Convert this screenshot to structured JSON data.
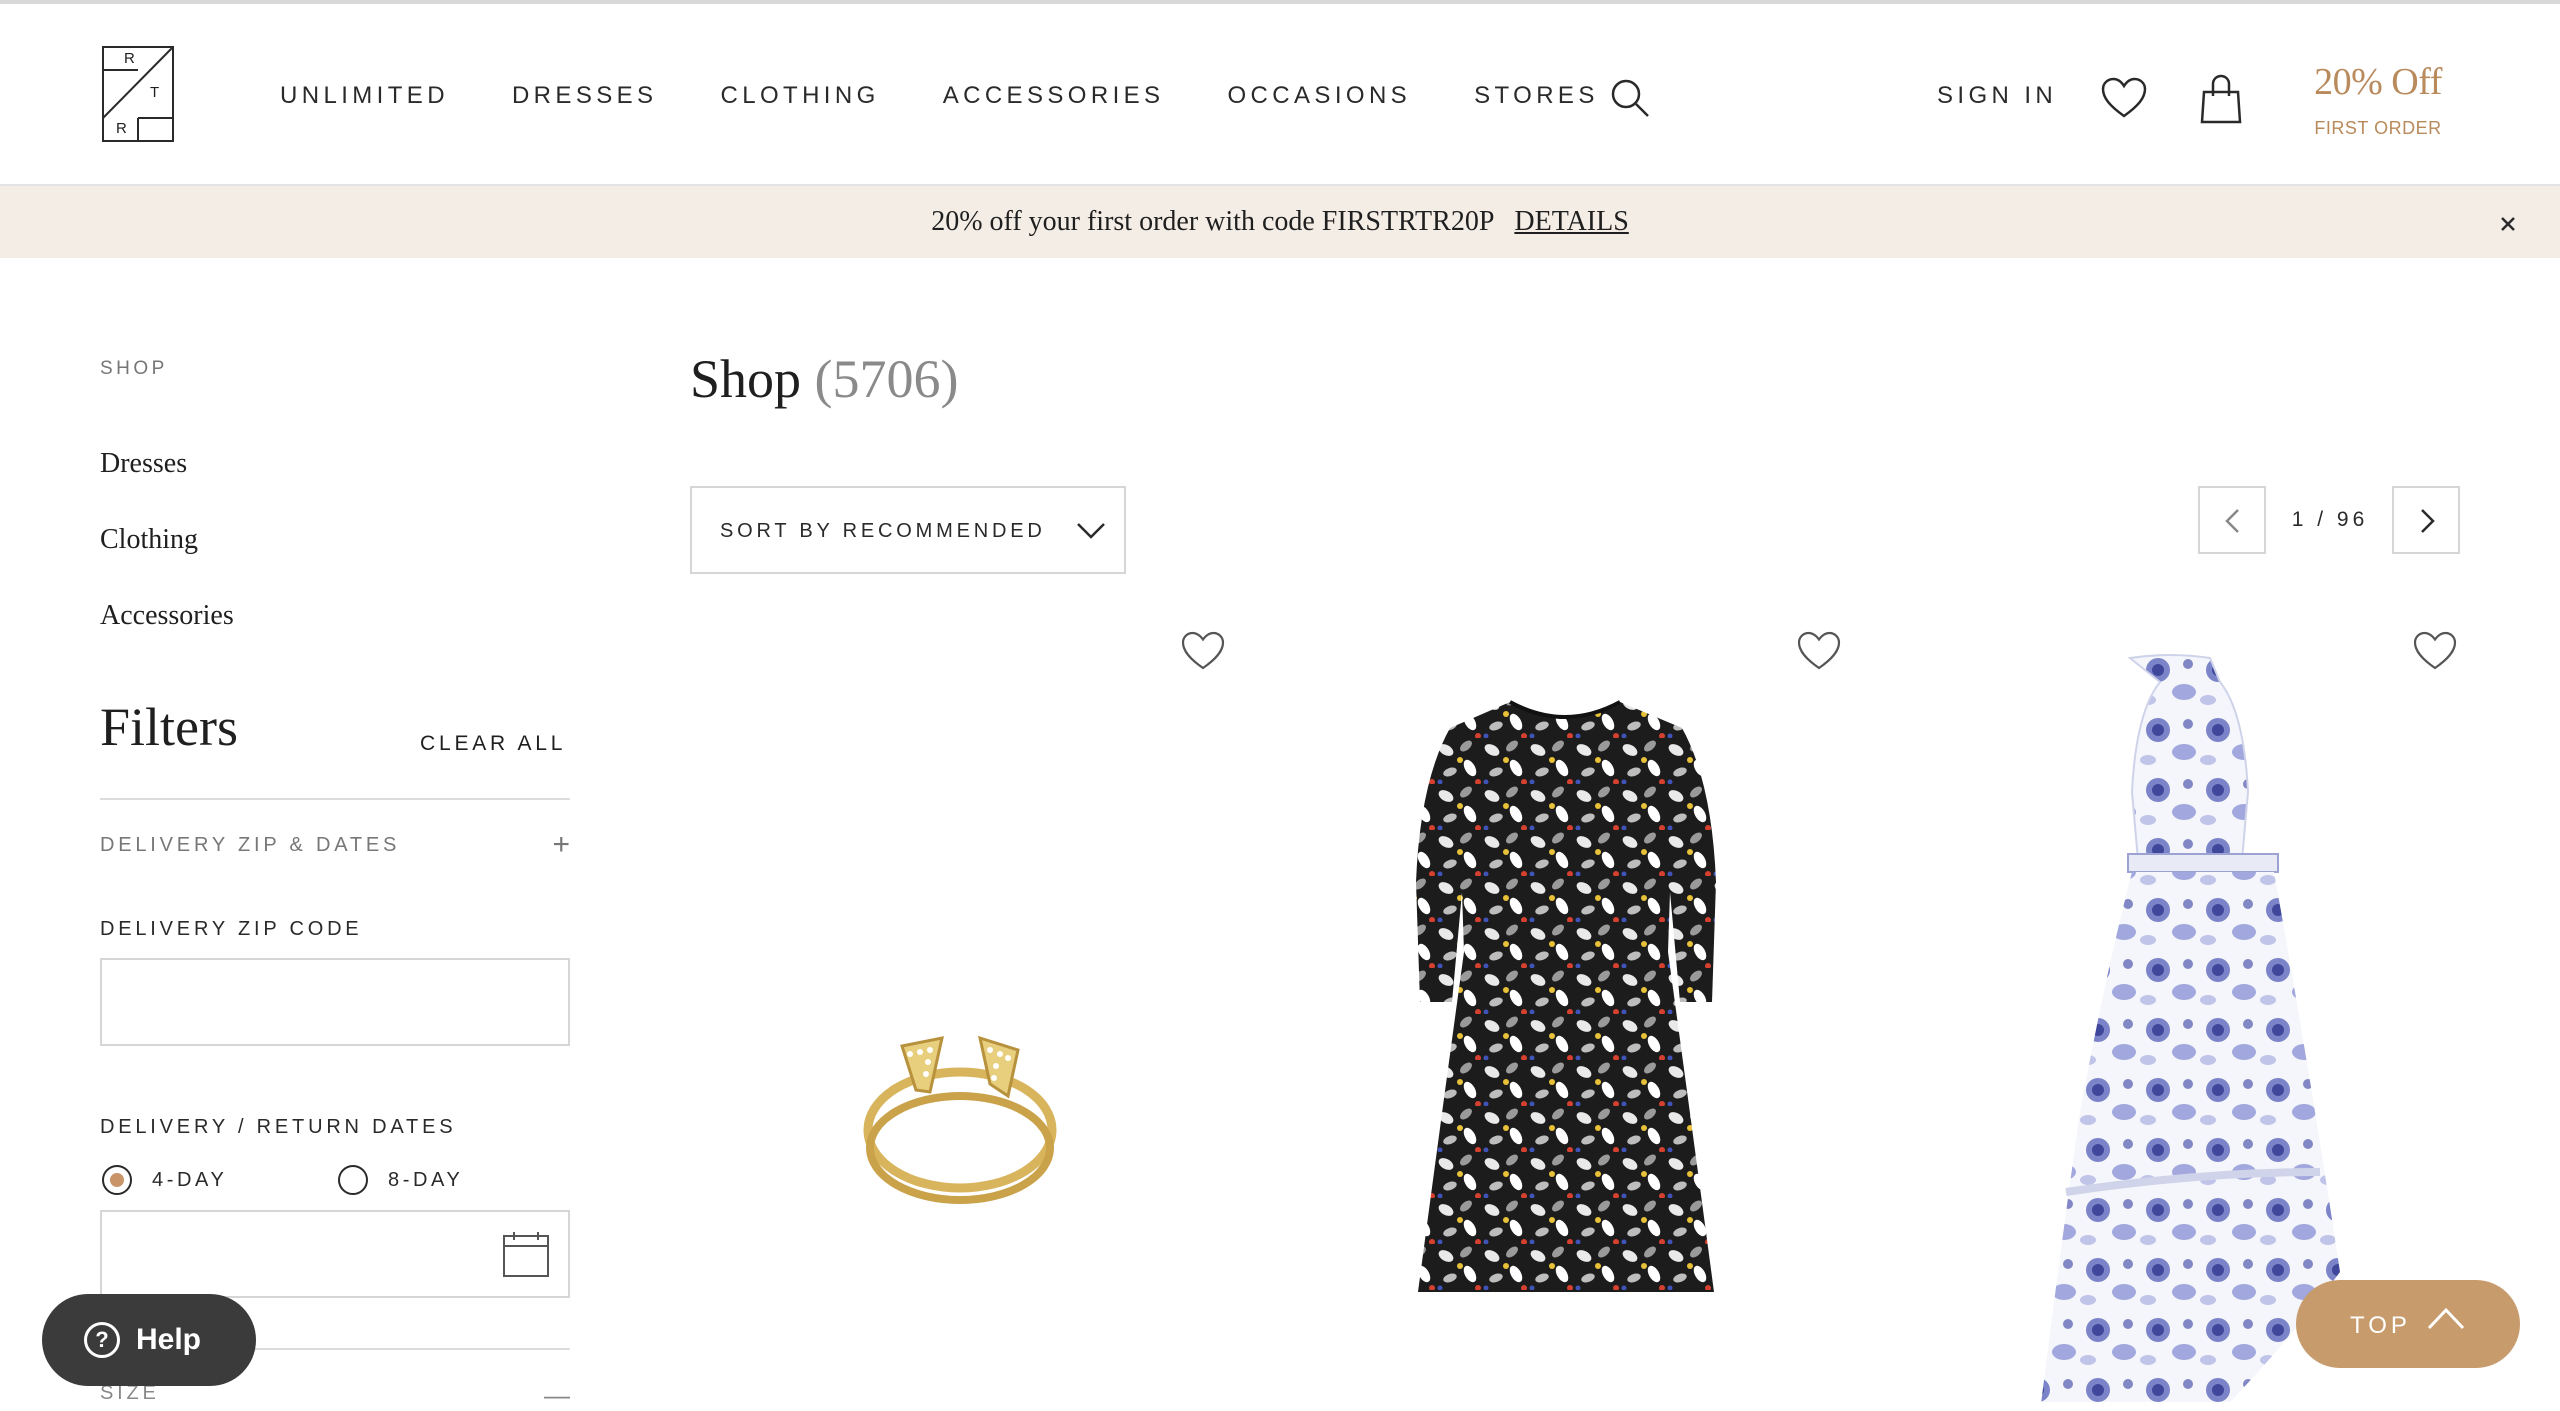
{
  "header": {
    "logo_letters": [
      "R",
      "T",
      "R"
    ],
    "nav": [
      "UNLIMITED",
      "DRESSES",
      "CLOTHING",
      "ACCESSORIES",
      "OCCASIONS",
      "STORES"
    ],
    "sign_in": "SIGN IN",
    "promo_title": "20% Off",
    "promo_subtitle": "FIRST ORDER"
  },
  "banner": {
    "text": "20% off your first order with code FIRSTRTR20P",
    "details": "DETAILS"
  },
  "sidebar": {
    "section_label": "SHOP",
    "links": [
      "Dresses",
      "Clothing",
      "Accessories"
    ],
    "filters_title": "Filters",
    "clear_all": "CLEAR ALL",
    "delivery_zip_dates": "DELIVERY ZIP & DATES",
    "zip_label": "DELIVERY ZIP CODE",
    "zip_value": "",
    "dates_label": "DELIVERY / RETURN DATES",
    "radio_options": [
      "4-DAY",
      "8-DAY"
    ],
    "radio_selected": "4-DAY",
    "size_label": "SIZE"
  },
  "main": {
    "title": "Shop",
    "count": "(5706)",
    "sort_label": "SORT BY RECOMMENDED",
    "pager": "1 / 96"
  },
  "products": [
    {
      "kind": "ring"
    },
    {
      "kind": "floral-black-dress"
    },
    {
      "kind": "blue-floral-halter-dress"
    }
  ],
  "floating": {
    "help": "Help",
    "top": "TOP"
  },
  "colors": {
    "accent": "#c79b6c",
    "banner_bg": "#f3ede6",
    "help_bg": "#3b3b3b"
  }
}
